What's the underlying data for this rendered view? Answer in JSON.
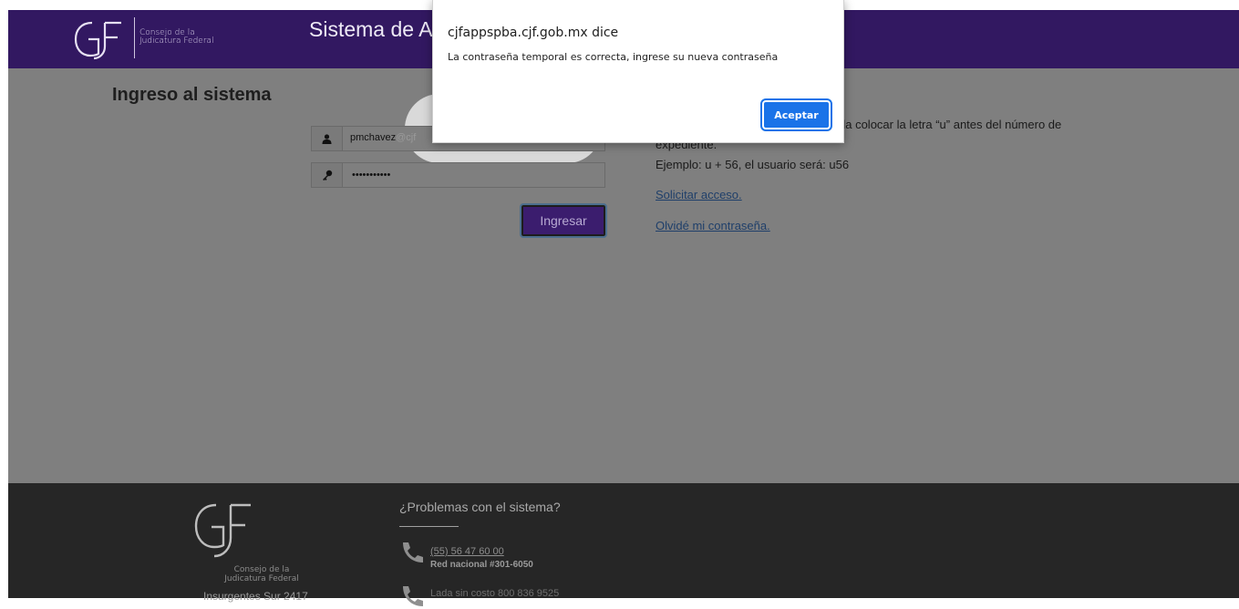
{
  "header": {
    "logo_line1": "Consejo de la",
    "logo_line2": "Judicatura Federal",
    "title": "Sistema de A"
  },
  "login": {
    "heading": "Ingreso al sistema",
    "username_value": "pmchavez",
    "username_faded": "@cjf",
    "password_value": "•••••••••••",
    "submit_label": "Ingresar"
  },
  "info": {
    "line1": "da colocar la letra “u” antes del número de",
    "line2": "expediente.",
    "line3": "Ejemplo: u + 56, el usuario será: u56",
    "request_access": "Solicitar acceso.",
    "forgot_password": "Olvidé mi contraseña."
  },
  "footer": {
    "logo_line1": "Consejo de la",
    "logo_line2": "Judicatura Federal",
    "partial_text": "Insurgentes Sur 2417",
    "help_heading": "¿Problemas con el sistema?",
    "phone": "(55) 56 47 60 00",
    "network": "Red nacional #301-6050",
    "toll_free": "Lada sin costo 800 836 9525"
  },
  "dialog": {
    "title": "cjfappspba.cjf.gob.mx dice",
    "message": "La contraseña temporal es correcta, ingrese su nueva contraseña",
    "ok_label": "Aceptar"
  },
  "colors": {
    "header_bg": "#321861",
    "overlay_gray": "#7f7f7f",
    "footer_bg": "#262626",
    "primary_button": "#1a73e8"
  }
}
